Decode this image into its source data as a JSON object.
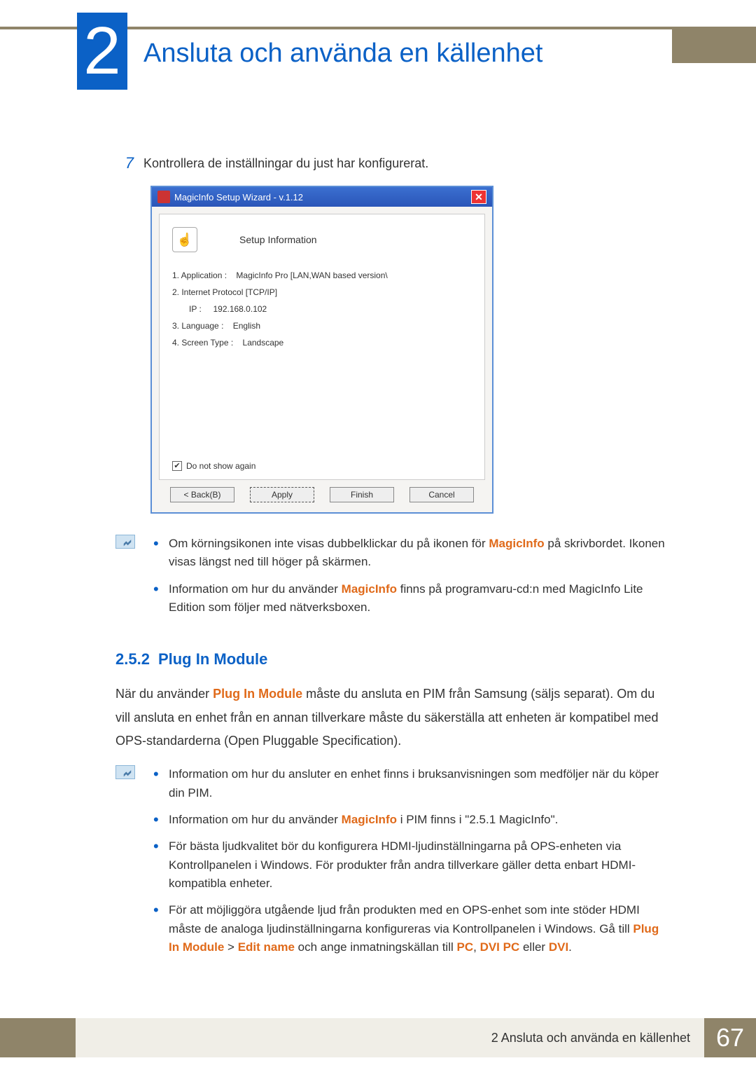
{
  "chapter": {
    "number": "2",
    "title": "Ansluta och använda en källenhet"
  },
  "step": {
    "number": "7",
    "text": "Kontrollera de inställningar du just har konfigurerat."
  },
  "wizard": {
    "title": "MagicInfo Setup Wizard - v.1.12",
    "info_title": "Setup Information",
    "line1_label": "1. Application :",
    "line1_value": "MagicInfo Pro [LAN,WAN based version\\",
    "line2": "2. Internet Protocol [TCP/IP]",
    "line2_ip_label": "IP :",
    "line2_ip_value": "192.168.0.102",
    "line3_label": "3. Language :",
    "line3_value": "English",
    "line4_label": "4. Screen Type :",
    "line4_value": "Landscape",
    "checkbox_label": "Do not show again",
    "buttons": {
      "back": "< Back(B)",
      "apply": "Apply",
      "finish": "Finish",
      "cancel": "Cancel"
    }
  },
  "notes1": {
    "item1_a": "Om körningsikonen inte visas dubbelklickar du på ikonen för ",
    "item1_mi": "MagicInfo",
    "item1_b": " på skrivbordet. Ikonen visas längst ned till höger på skärmen.",
    "item2_a": "Information om hur du använder ",
    "item2_mi": "MagicInfo",
    "item2_b": " finns på programvaru-cd:n med MagicInfo Lite Edition som följer med nätverksboxen."
  },
  "section": {
    "number": "2.5.2",
    "title": "Plug In Module"
  },
  "para": {
    "a": "När du använder ",
    "pim": "Plug In Module",
    "b": " måste du ansluta en PIM från Samsung (säljs separat). Om du vill ansluta en enhet från en annan tillverkare måste du säkerställa att enheten är kompatibel med OPS-standarderna (Open Pluggable Specification)."
  },
  "notes2": {
    "item1": "Information om hur du ansluter en enhet finns i bruksanvisningen som medföljer när du köper din PIM.",
    "item2_a": "Information om hur du använder ",
    "item2_mi": "MagicInfo",
    "item2_b": " i PIM finns i \"2.5.1    MagicInfo\".",
    "item3": "För bästa ljudkvalitet bör du konfigurera HDMI-ljudinställningarna på OPS-enheten via Kontrollpanelen i Windows. För produkter från andra tillverkare gäller detta enbart HDMI-kompatibla enheter.",
    "item4_a": "För att möjliggöra utgående ljud från produkten med en OPS-enhet som inte stöder HDMI måste de analoga ljudinställningarna konfigureras via Kontrollpanelen i Windows. Gå till ",
    "item4_pim": "Plug In Module",
    "item4_gt": " > ",
    "item4_edit": "Edit name",
    "item4_b": " och ange inmatningskällan till ",
    "item4_pc": "PC",
    "item4_c1": ", ",
    "item4_dvipc": "DVI PC",
    "item4_c2": " eller ",
    "item4_dvi": "DVI",
    "item4_end": "."
  },
  "footer": {
    "text": "2 Ansluta och använda en källenhet",
    "page": "67"
  }
}
